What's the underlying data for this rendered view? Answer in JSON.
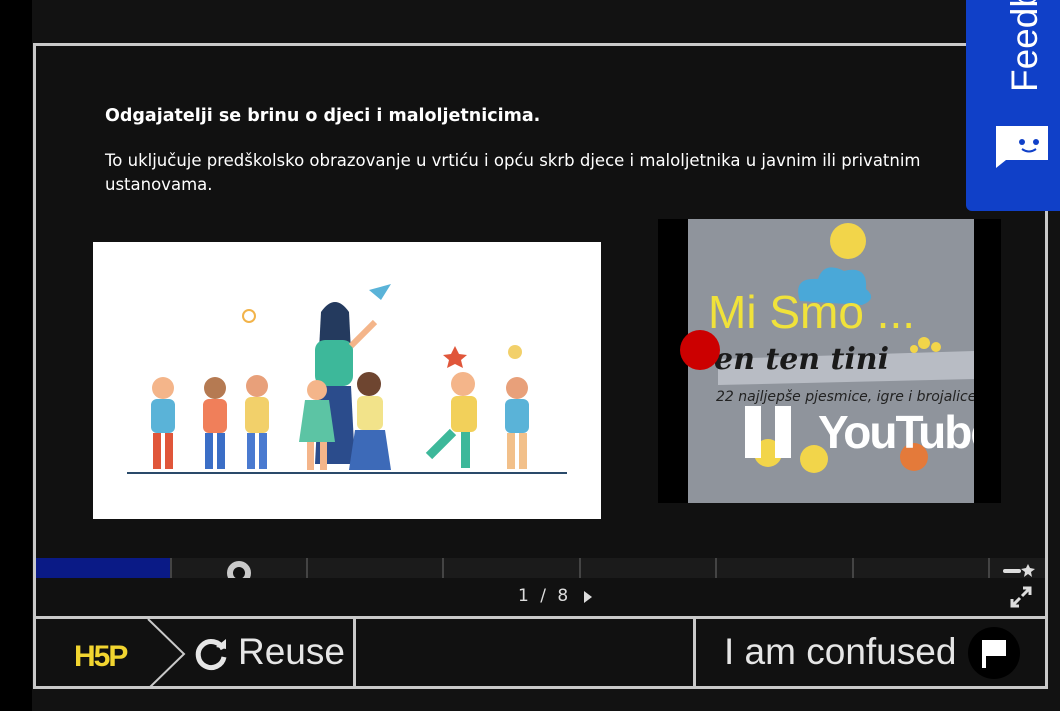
{
  "slide": {
    "heading": "Odgajatelji se brinu o djeci i maloljetnicima.",
    "description": "To uključuje predškolsko obrazovanje u vrtiću i opću skrb djece i maloljetnika u javnim ili privatnim ustanovama."
  },
  "video": {
    "title": "Mi Smo ...",
    "thumbnail_text": "en ten tini",
    "thumbnail_subtitle": "22 najljepše pjesmice, igre i brojalice",
    "platform": "YouTube"
  },
  "navigation": {
    "current": "1",
    "separator": "/",
    "total": "8",
    "progress_fraction": 0.125
  },
  "footer": {
    "logo": "H5P",
    "reuse_label": "Reuse",
    "confused_label": "I am confused"
  },
  "feedback_tab": {
    "label": "Feedback"
  },
  "colors": {
    "accent_blue": "#1040c8",
    "progress_fill": "#0a1a86",
    "logo_yellow": "#f2d530",
    "video_title_yellow": "#f0e23a"
  },
  "icons": [
    "pause-icon",
    "record-dot-icon",
    "next-arrow-icon",
    "fullscreen-icon",
    "menu-star-icon",
    "h5p-logo",
    "refresh-icon",
    "flag-icon",
    "feedback-chat-icon"
  ]
}
